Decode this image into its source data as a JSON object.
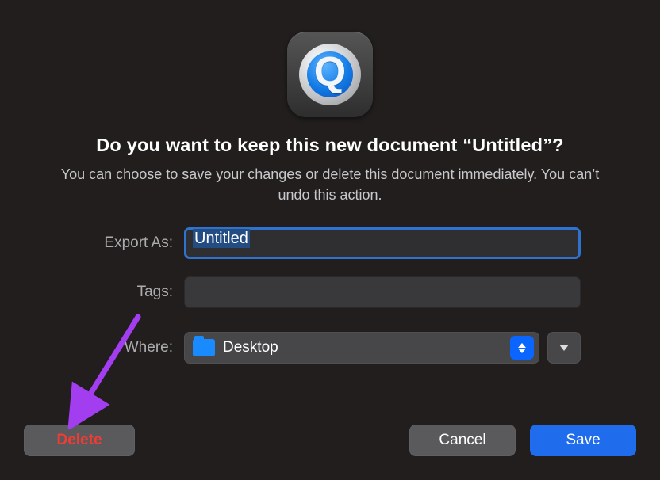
{
  "app_icon": {
    "letter": "Q",
    "name": "quicktime-icon"
  },
  "title": "Do you want to keep this new document “Untitled”?",
  "subtitle": "You can choose to save your changes or delete this document immediately. You can’t undo this action.",
  "form": {
    "export_as": {
      "label": "Export As:",
      "value": "Untitled"
    },
    "tags": {
      "label": "Tags:",
      "value": ""
    },
    "where": {
      "label": "Where:",
      "selected": "Desktop"
    }
  },
  "buttons": {
    "delete": "Delete",
    "cancel": "Cancel",
    "save": "Save"
  },
  "annotation": {
    "arrow_color": "#a23df0"
  }
}
